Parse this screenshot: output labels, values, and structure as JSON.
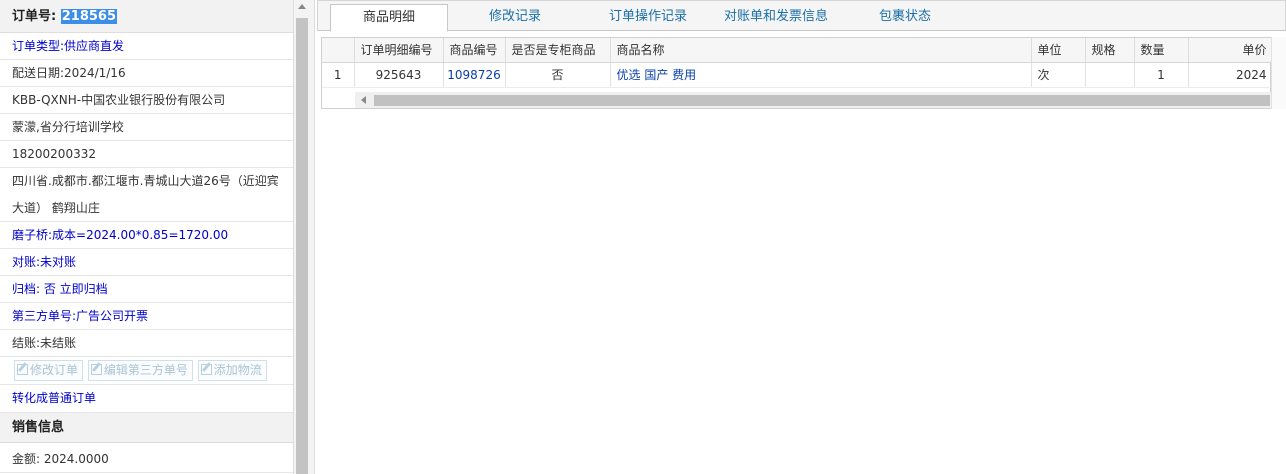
{
  "order": {
    "no_label": "订单号:",
    "no_value": "218565",
    "type": "订单类型:供应商直发",
    "delivery_date": "配送日期:2024/1/16",
    "company": "KBB-QXNH-中国农业银行股份有限公司",
    "contact": "蒙濛,省分行培训学校",
    "phone": "18200200332",
    "address": "四川省.成都市.都江堰市.青城山大道26号（近迎宾大道） 鹤翔山庄",
    "cost": "磨子桥:成本=2024.00*0.85=1720.00",
    "reconcile": "对账:未对账",
    "archive": "归档: 否 立即归档",
    "third_party": "第三方单号:广告公司开票",
    "settlement": "结账:未结账",
    "buttons": [
      "修改订单",
      "编辑第三方单号",
      "添加物流"
    ],
    "convert_link": "转化成普通订单"
  },
  "sales": {
    "title": "销售信息",
    "amount": "金额: 2024.0000"
  },
  "tabs": [
    "商品明细",
    "修改记录",
    "订单操作记录",
    "对账单和发票信息",
    "包裹状态"
  ],
  "table": {
    "headers": [
      "",
      "订单明细编号",
      "商品编号",
      "是否是专柜商品",
      "商品名称",
      "单位",
      "规格",
      "数量",
      "单价"
    ],
    "rows": [
      [
        "1",
        "925643",
        "1098726",
        "否",
        "优选 国产 费用",
        "次",
        "",
        "1",
        "2024"
      ]
    ]
  },
  "colors": {
    "link": "#0000cc",
    "tab_text": "#1a6fa8",
    "selection": "#3d8ee6"
  }
}
